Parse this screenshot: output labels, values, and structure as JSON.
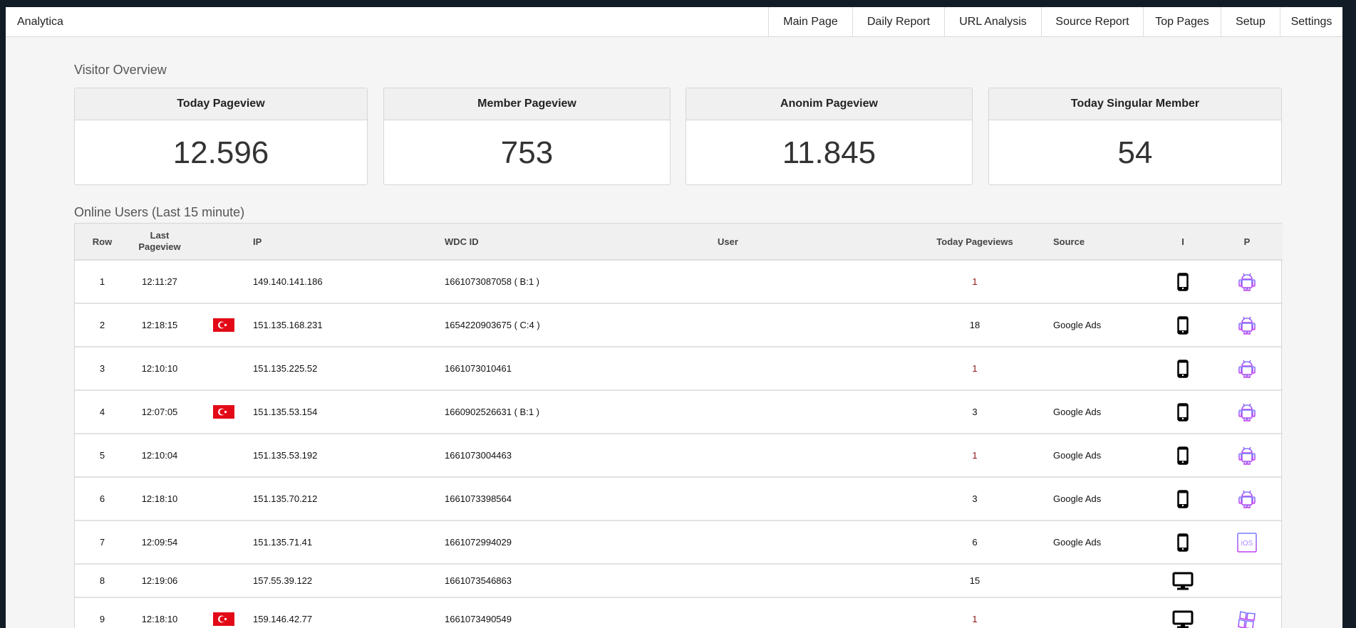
{
  "app": {
    "title": "Analytica"
  },
  "nav": [
    {
      "label": "Main Page"
    },
    {
      "label": "Daily Report"
    },
    {
      "label": "URL Analysis"
    },
    {
      "label": "Source Report"
    },
    {
      "label": "Top Pages"
    },
    {
      "label": "Setup"
    },
    {
      "label": "Settings"
    }
  ],
  "overview": {
    "title": "Visitor Overview",
    "cards": [
      {
        "label": "Today Pageview",
        "value": "12.596"
      },
      {
        "label": "Member Pageview",
        "value": "753"
      },
      {
        "label": "Anonim Pageview",
        "value": "11.845"
      },
      {
        "label": "Today Singular Member",
        "value": "54"
      }
    ]
  },
  "online": {
    "title": "Online Users (Last 15 minute)",
    "columns": {
      "row": "Row",
      "last": "Last Pageview",
      "ip": "IP",
      "wdc": "WDC ID",
      "user": "User",
      "today": "Today Pageviews",
      "source": "Source",
      "i": "I",
      "p": "P"
    },
    "rows": [
      {
        "row": "1",
        "last": "12:11:27",
        "flag": "",
        "ip": "149.140.141.186",
        "wdc": "1661073087058 ( B:1 )",
        "user": "",
        "today": "1",
        "source": "",
        "device": "phone-icon",
        "platform": "android-icon"
      },
      {
        "row": "2",
        "last": "12:18:15",
        "flag": "tr",
        "ip": "151.135.168.231",
        "wdc": "1654220903675 ( C:4 )",
        "user": "",
        "today": "18",
        "source": "Google Ads",
        "device": "phone-icon",
        "platform": "android-icon"
      },
      {
        "row": "3",
        "last": "12:10:10",
        "flag": "",
        "ip": "151.135.225.52",
        "wdc": "1661073010461",
        "user": "",
        "today": "1",
        "source": "",
        "device": "phone-icon",
        "platform": "android-icon"
      },
      {
        "row": "4",
        "last": "12:07:05",
        "flag": "tr",
        "ip": "151.135.53.154",
        "wdc": "1660902526631 ( B:1 )",
        "user": "",
        "today": "3",
        "source": "Google Ads",
        "device": "phone-icon",
        "platform": "android-icon"
      },
      {
        "row": "5",
        "last": "12:10:04",
        "flag": "",
        "ip": "151.135.53.192",
        "wdc": "1661073004463",
        "user": "",
        "today": "1",
        "source": "Google Ads",
        "device": "phone-icon",
        "platform": "android-icon"
      },
      {
        "row": "6",
        "last": "12:18:10",
        "flag": "",
        "ip": "151.135.70.212",
        "wdc": "1661073398564",
        "user": "",
        "today": "3",
        "source": "Google Ads",
        "device": "phone-icon",
        "platform": "android-icon"
      },
      {
        "row": "7",
        "last": "12:09:54",
        "flag": "",
        "ip": "151.135.71.41",
        "wdc": "1661072994029",
        "user": "",
        "today": "6",
        "source": "Google Ads",
        "device": "phone-icon",
        "platform": "ios-icon"
      },
      {
        "row": "8",
        "last": "12:19:06",
        "flag": "",
        "ip": "157.55.39.122",
        "wdc": "1661073546863",
        "user": "",
        "today": "15",
        "source": "",
        "device": "desktop-icon",
        "platform": ""
      },
      {
        "row": "9",
        "last": "12:18:10",
        "flag": "tr",
        "ip": "159.146.42.77",
        "wdc": "1661073490549",
        "user": "",
        "today": "1",
        "source": "",
        "device": "desktop-icon",
        "platform": "windows-icon"
      }
    ]
  },
  "ios_label": "iOS",
  "colors": {
    "low_count": "#8b1010",
    "flag": "#e30a17",
    "platform_a": "#7a7cff",
    "platform_b": "#c23cf0"
  }
}
